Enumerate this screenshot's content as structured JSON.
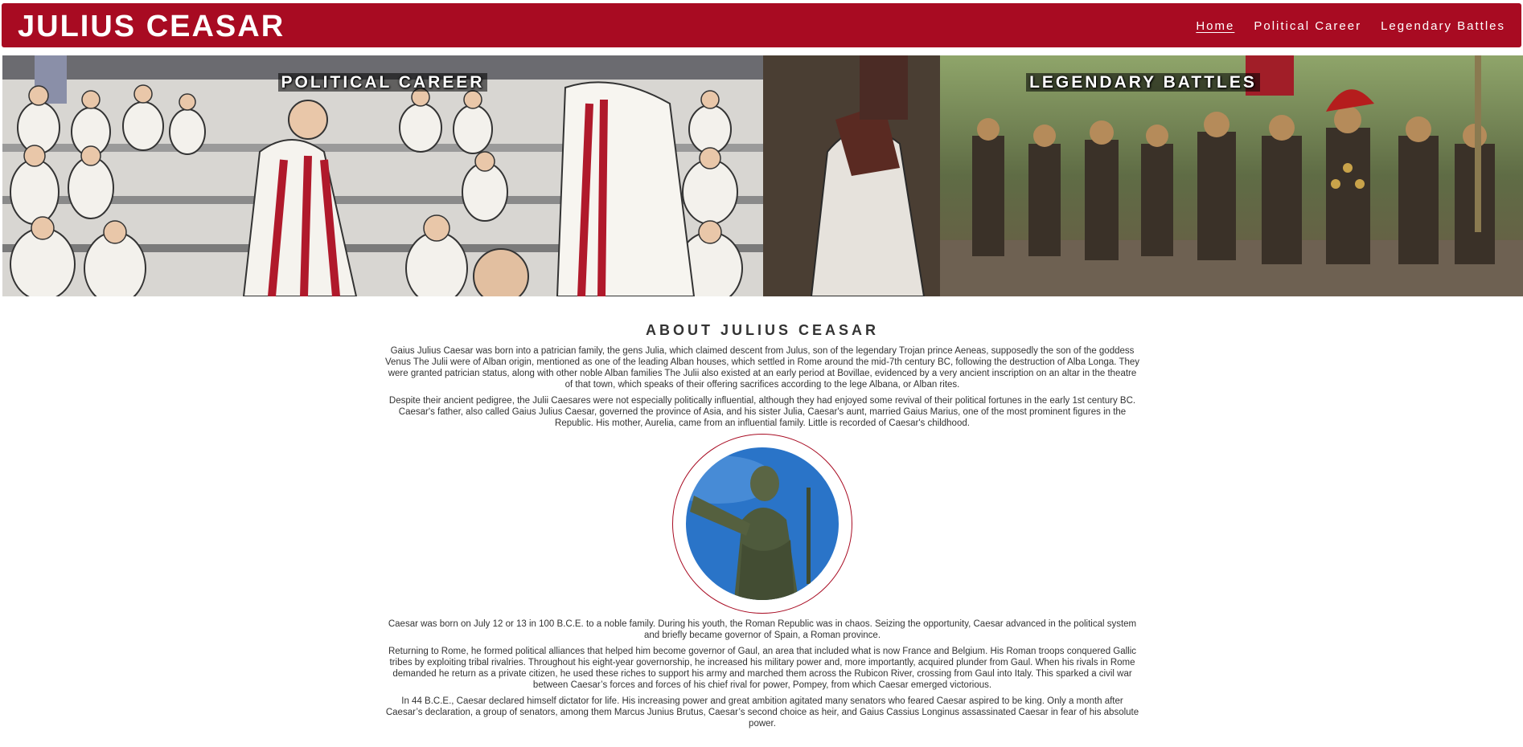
{
  "header": {
    "title": "JULIUS CEASAR",
    "nav": [
      "Home",
      "Political Career",
      "Legendary Battles"
    ]
  },
  "hero": {
    "left_title": "POLITICAL CAREER",
    "right_title": "LEGENDARY BATTLES"
  },
  "about": {
    "heading": "ABOUT JULIUS CEASAR",
    "p1": "Gaius Julius Caesar was born into a patrician family, the gens Julia, which claimed descent from Julus, son of the legendary Trojan prince Aeneas, supposedly the son of the goddess Venus The Julii were of Alban origin, mentioned as one of the leading Alban houses, which settled in Rome around the mid-7th century BC, following the destruction of Alba Longa. They were granted patrician status, along with other noble Alban families The Julii also existed at an early period at Bovillae, evidenced by a very ancient inscription on an altar in the theatre of that town, which speaks of their offering sacrifices according to the lege Albana, or Alban rites.",
    "p2": "Despite their ancient pedigree, the Julii Caesares were not especially politically influential, although they had enjoyed some revival of their political fortunes in the early 1st century BC. Caesar's father, also called Gaius Julius Caesar, governed the province of Asia, and his sister Julia, Caesar's aunt, married Gaius Marius, one of the most prominent figures in the Republic. His mother, Aurelia, came from an influential family. Little is recorded of Caesar's childhood.",
    "p3": "Caesar was born on July 12 or 13 in 100 B.C.E. to a noble family. During his youth, the Roman Republic was in chaos. Seizing the opportunity, Caesar advanced in the political system and briefly became governor of Spain, a Roman province.",
    "p4": "Returning to Rome, he formed political alliances that helped him become governor of Gaul, an area that included what is now France and Belgium. His Roman troops conquered Gallic tribes by exploiting tribal rivalries. Throughout his eight-year governorship, he increased his military power and, more importantly, acquired plunder from Gaul. When his rivals in Rome demanded he return as a private citizen, he used these riches to support his army and marched them across the Rubicon River, crossing from Gaul into Italy. This sparked a civil war between Caesar’s forces and forces of his chief rival for power, Pompey, from which Caesar emerged victorious.",
    "p5": "In 44 B.C.E., Caesar declared himself dictator for life. His increasing power and great ambition agitated many senators who feared Caesar aspired to be king. Only a month after Caesar’s declaration, a group of senators, among them Marcus Junius Brutus, Caesar’s second choice as heir, and Gaius Cassius Longinus assassinated Caesar in fear of his absolute power."
  },
  "colors": {
    "brand": "#a80b22",
    "sky": "#2a74c8",
    "bronze": "#4e5a3c"
  }
}
